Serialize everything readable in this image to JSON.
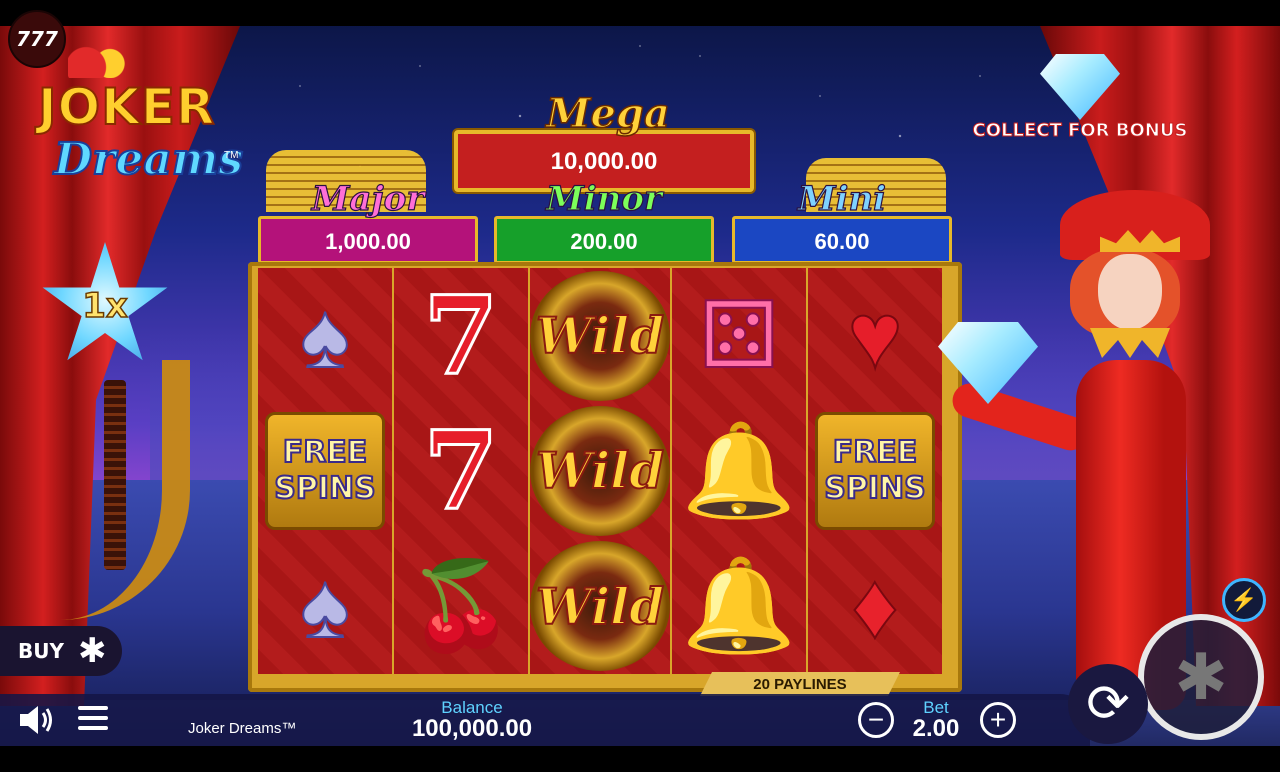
{
  "brand": {
    "badge": "777"
  },
  "logo": {
    "line1": "JOKER",
    "line2": "Dreams",
    "tm": "TM"
  },
  "multiplier": {
    "value": "1x"
  },
  "buy": {
    "label": "BUY",
    "icon": "asterisk-icon"
  },
  "jackpots": {
    "mega": {
      "title": "Mega",
      "value": "10,000.00"
    },
    "major": {
      "title": "Major",
      "value": "1,000.00"
    },
    "minor": {
      "title": "Minor",
      "value": "200.00"
    },
    "mini": {
      "title": "Mini",
      "value": "60.00"
    }
  },
  "reels": [
    [
      "spade",
      "free-spins",
      "spade"
    ],
    [
      "seven",
      "seven",
      "cherry"
    ],
    [
      "wild",
      "wild",
      "wild"
    ],
    [
      "dice",
      "bell",
      "bell"
    ],
    [
      "heart",
      "free-spins",
      "diamond"
    ]
  ],
  "symbol_text": {
    "free1": "FREE",
    "free2": "SPINS",
    "wild": "Wild"
  },
  "paylines": "20 PAYLINES",
  "bonus": {
    "label": "COLLECT FOR BONUS",
    "icon": "diamond-icon"
  },
  "hud": {
    "game_name": "Joker Dreams™",
    "balance_label": "Balance",
    "balance_value": "100,000.00",
    "bet_label": "Bet",
    "bet_value": "2.00",
    "minus": "−",
    "plus": "+"
  },
  "colors": {
    "accent_blue": "#5fd2ff",
    "gold": "#e7b92a",
    "reel_red": "#a81616"
  }
}
